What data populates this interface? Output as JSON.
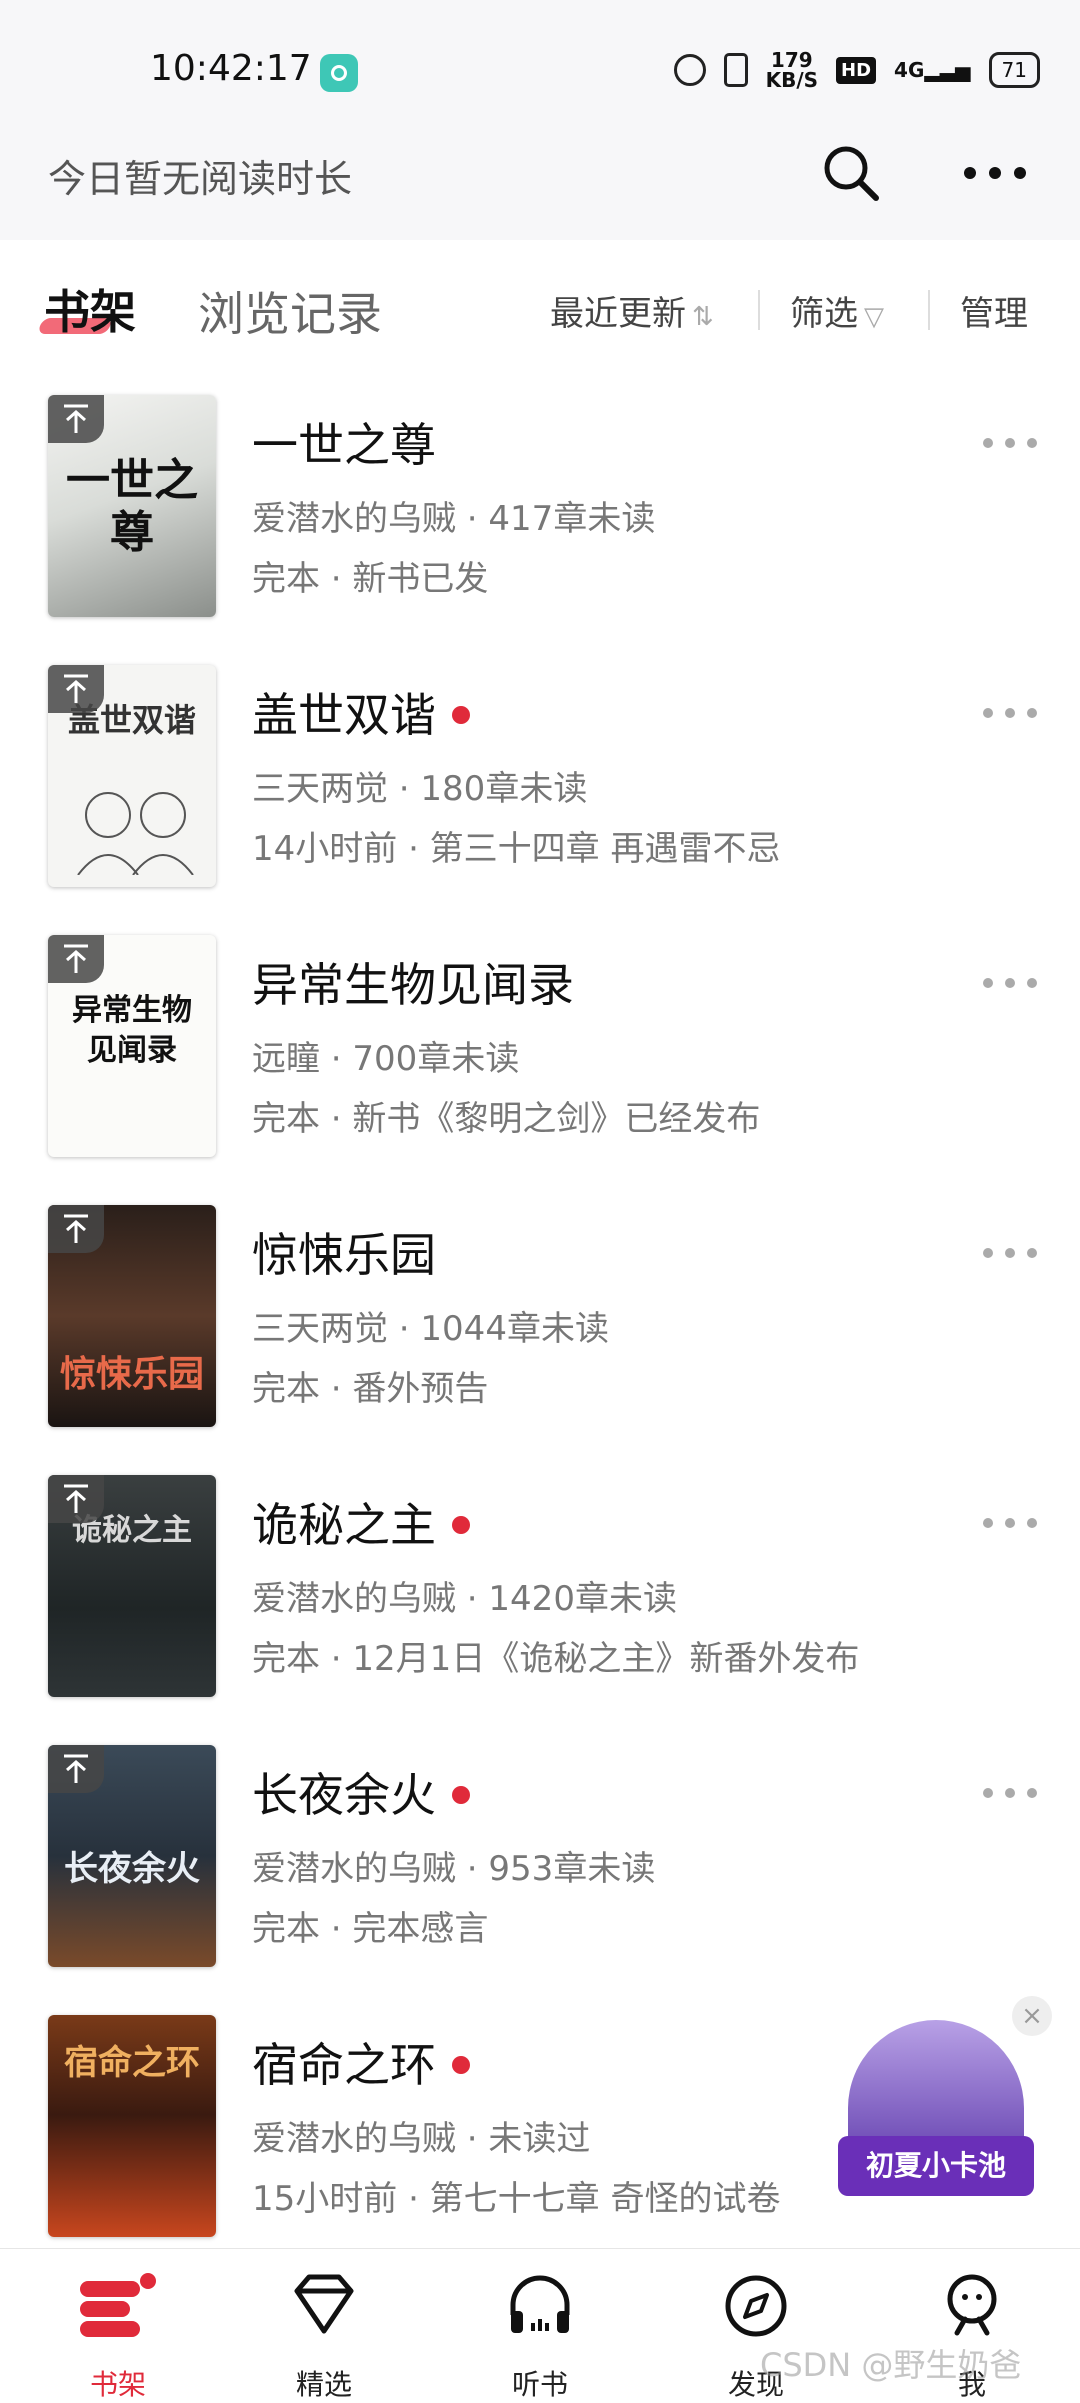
{
  "status_bar": {
    "time": "10:42:17",
    "net_speed_value": "179",
    "net_speed_unit": "KB/S",
    "hd": "HD",
    "signal": "4G",
    "battery": "71"
  },
  "header": {
    "reading_time": "今日暂无阅读时长",
    "icons": [
      "search-icon",
      "more-icon"
    ]
  },
  "tabs": {
    "shelf": "书架",
    "history": "浏览记录"
  },
  "toolbar": {
    "sort": "最近更新",
    "filter": "筛选",
    "manage": "管理"
  },
  "books": [
    {
      "title": "一世之尊",
      "meta": "爱潜水的乌贼 · 417章未读",
      "note": "完本 · 新书已发",
      "cover_text": "一世之尊",
      "new": false
    },
    {
      "title": "盖世双谐",
      "meta": "三天两觉 · 180章未读",
      "note": "14小时前 · 第三十四章 再遇雷不忌",
      "cover_text": "盖世双谐",
      "new": true
    },
    {
      "title": "异常生物见闻录",
      "meta": "远瞳 · 700章未读",
      "note": "完本 · 新书《黎明之剑》已经发布",
      "cover_text": "异常生物见闻录",
      "new": false
    },
    {
      "title": "惊悚乐园",
      "meta": "三天两觉 · 1044章未读",
      "note": "完本 · 番外预告",
      "cover_text": "惊悚乐园",
      "new": false
    },
    {
      "title": "诡秘之主",
      "meta": "爱潜水的乌贼 · 1420章未读",
      "note": "完本 · 12月1日《诡秘之主》新番外发布",
      "cover_text": "诡秘之主",
      "new": true
    },
    {
      "title": "长夜余火",
      "meta": "爱潜水的乌贼 · 953章未读",
      "note": "完本 · 完本感言",
      "cover_text": "长夜余火",
      "new": true
    },
    {
      "title": "宿命之环",
      "meta": "爱潜水的乌贼 · 未读过",
      "note": "15小时前 · 第七十七章 奇怪的试卷",
      "cover_text": "宿命之环",
      "new": true
    }
  ],
  "promo": {
    "label": "初夏小卡池"
  },
  "bottom_nav": [
    {
      "label": "书架",
      "icon": "bookshelf-icon",
      "active": true
    },
    {
      "label": "精选",
      "icon": "diamond-icon",
      "active": false
    },
    {
      "label": "听书",
      "icon": "headphones-icon",
      "active": false
    },
    {
      "label": "发现",
      "icon": "compass-icon",
      "active": false
    },
    {
      "label": "我",
      "icon": "profile-icon",
      "active": false
    }
  ],
  "watermark": "CSDN @野生奶爸",
  "colors": {
    "accent": "#e02a3a",
    "header_bg": "#f7f7f9",
    "text_secondary": "#777777"
  }
}
